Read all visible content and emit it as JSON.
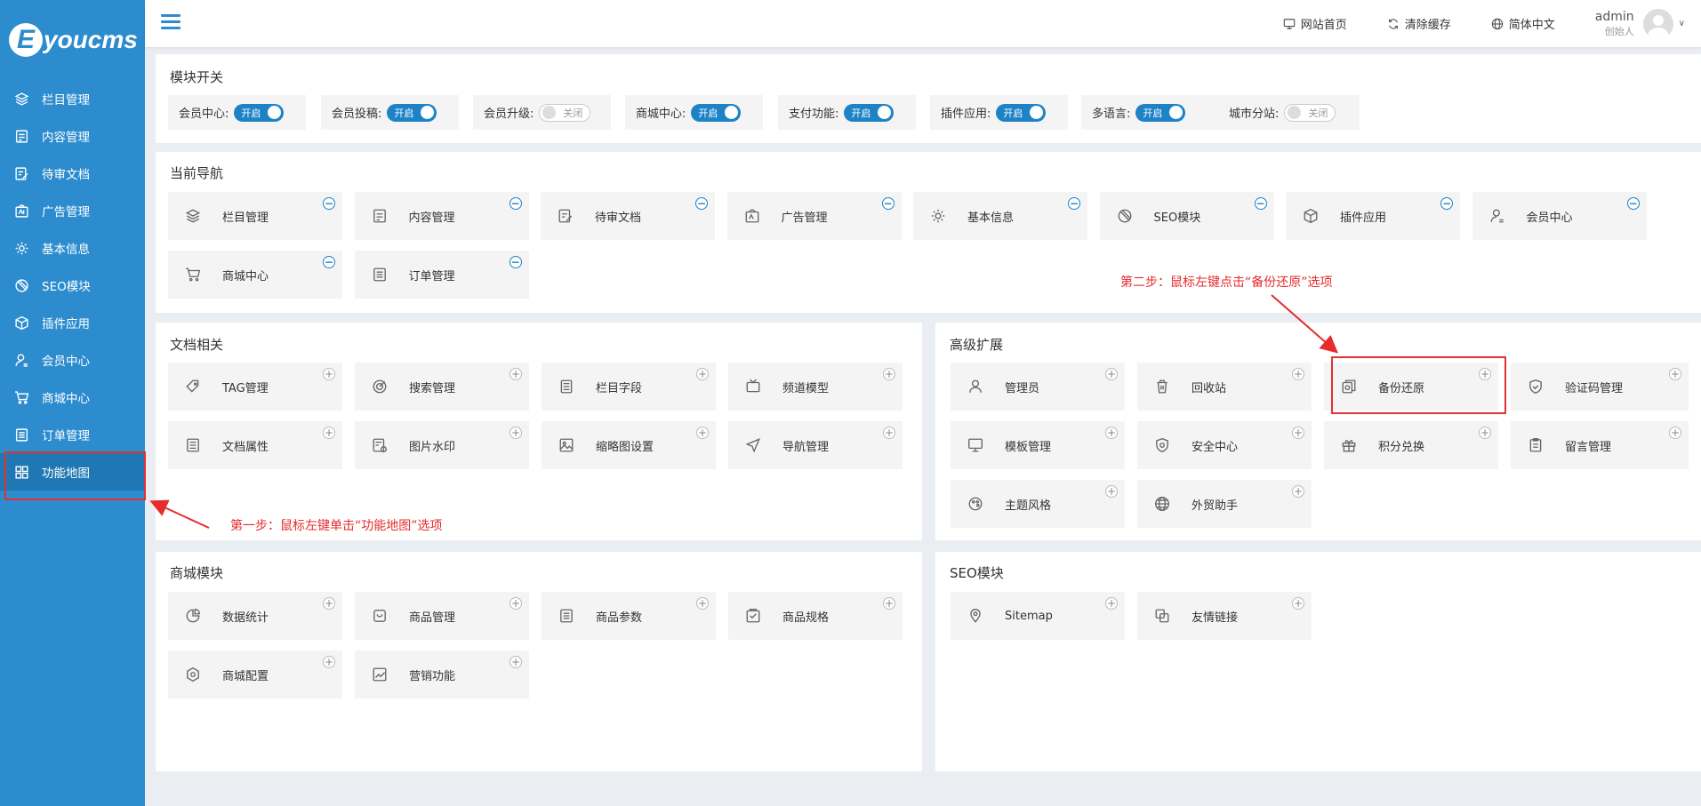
{
  "logo": {
    "mark": "E",
    "text": "youcms"
  },
  "sidebar": {
    "items": [
      {
        "label": "栏目管理",
        "icon": "layers-icon"
      },
      {
        "label": "内容管理",
        "icon": "document-icon"
      },
      {
        "label": "待审文档",
        "icon": "edit-doc-icon"
      },
      {
        "label": "广告管理",
        "icon": "ad-icon"
      },
      {
        "label": "基本信息",
        "icon": "gear-icon"
      },
      {
        "label": "SEO模块",
        "icon": "seo-icon"
      },
      {
        "label": "插件应用",
        "icon": "cube-icon"
      },
      {
        "label": "会员中心",
        "icon": "user-icon"
      },
      {
        "label": "商城中心",
        "icon": "cart-icon"
      },
      {
        "label": "订单管理",
        "icon": "list-icon"
      },
      {
        "label": "功能地图",
        "icon": "grid-icon",
        "active": true
      }
    ]
  },
  "header": {
    "home": "网站首页",
    "clear_cache": "清除缓存",
    "language": "简体中文",
    "user": {
      "name": "admin",
      "role": "创始人"
    }
  },
  "switches": {
    "title": "模块开关",
    "items": [
      {
        "label": "会员中心:",
        "state": "开启",
        "on": true
      },
      {
        "label": "会员投稿:",
        "state": "开启",
        "on": true
      },
      {
        "label": "会员升级:",
        "state": "关闭",
        "on": false
      },
      {
        "label": "商城中心:",
        "state": "开启",
        "on": true
      },
      {
        "label": "支付功能:",
        "state": "开启",
        "on": true
      },
      {
        "label": "插件应用:",
        "state": "开启",
        "on": true
      },
      {
        "label": "多语言:",
        "state": "开启",
        "on": true
      },
      {
        "label": "城市分站:",
        "state": "关闭",
        "on": false
      }
    ]
  },
  "current_nav": {
    "title": "当前导航",
    "items": [
      "栏目管理",
      "内容管理",
      "待审文档",
      "广告管理",
      "基本信息",
      "SEO模块",
      "插件应用",
      "会员中心",
      "商城中心",
      "订单管理"
    ]
  },
  "doc_related": {
    "title": "文档相关",
    "items": [
      "TAG管理",
      "搜索管理",
      "栏目字段",
      "频道模型",
      "文档属性",
      "图片水印",
      "缩略图设置",
      "导航管理"
    ]
  },
  "advanced": {
    "title": "高级扩展",
    "items": [
      "管理员",
      "回收站",
      "备份还原",
      "验证码管理",
      "模板管理",
      "安全中心",
      "积分兑换",
      "留言管理",
      "主题风格",
      "外贸助手"
    ]
  },
  "shop_module": {
    "title": "商城模块",
    "items": [
      "数据统计",
      "商品管理",
      "商品参数",
      "商品规格",
      "商城配置",
      "营销功能"
    ]
  },
  "seo_module": {
    "title": "SEO模块",
    "items": [
      "Sitemap",
      "友情链接"
    ]
  },
  "annotations": {
    "step1": "第一步：鼠标左键单击“功能地图”选项",
    "step2": "第二步：鼠标左键点击“备份还原”选项",
    "color": "#e62b2b"
  }
}
